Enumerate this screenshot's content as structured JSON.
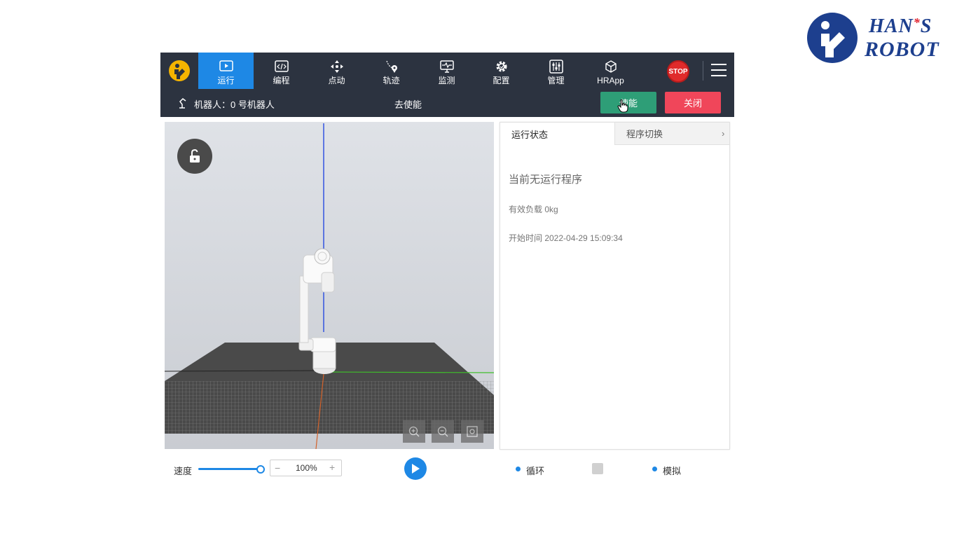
{
  "brand": {
    "line1": "HAN",
    "star": "*",
    "line1_suffix": "S",
    "line2": "ROBOT"
  },
  "nav": {
    "items": [
      {
        "label": "运行",
        "icon": "play-icon",
        "active": true
      },
      {
        "label": "编程",
        "icon": "code-icon",
        "active": false
      },
      {
        "label": "点动",
        "icon": "move-arrows-icon",
        "active": false
      },
      {
        "label": "轨迹",
        "icon": "path-pin-icon",
        "active": false
      },
      {
        "label": "监测",
        "icon": "monitor-icon",
        "active": false
      },
      {
        "label": "配置",
        "icon": "gear-icon",
        "active": false
      },
      {
        "label": "管理",
        "icon": "sliders-icon",
        "active": false
      },
      {
        "label": "HRApp",
        "icon": "cube-icon",
        "active": false
      }
    ],
    "stop_label": "STOP"
  },
  "status": {
    "robot_label": "机器人：0 号机器人",
    "disable_label": "去使能",
    "enable_button": "使能",
    "close_button": "关闭"
  },
  "panel": {
    "tabs": [
      "运行状态",
      "程序切换"
    ],
    "no_program": "当前无运行程序",
    "payload": "有效负载 0kg",
    "start_time": "开始时间 2022-04-29 15:09:34"
  },
  "bottom": {
    "speed_label": "速度",
    "speed_value": "100%",
    "speed_fraction": 1.0,
    "minus": "−",
    "plus": "+",
    "loop_label": "循环",
    "sim_label": "模拟"
  },
  "colors": {
    "nav_bg": "#2c3340",
    "accent": "#1e88e5",
    "enable_green": "#2e9e77",
    "close_red": "#f0465a",
    "stop_red": "#e02b2b"
  }
}
